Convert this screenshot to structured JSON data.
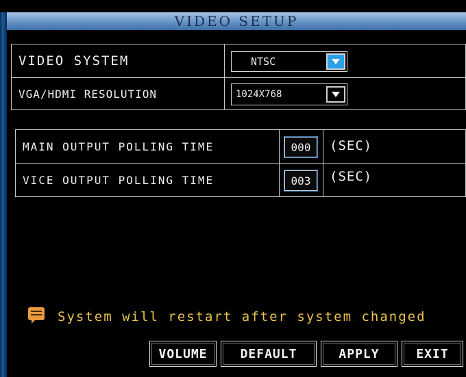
{
  "window": {
    "title": "VIDEO SETUP"
  },
  "settings": {
    "video_system": {
      "label": "VIDEO SYSTEM",
      "value": "NTSC"
    },
    "vga_hdmi_resolution": {
      "label": "VGA/HDMI RESOLUTION",
      "value": "1024X768"
    },
    "main_output_polling": {
      "label": "MAIN OUTPUT POLLING TIME",
      "value": "000",
      "unit": "(SEC)"
    },
    "vice_output_polling": {
      "label": "VICE OUTPUT POLLING TIME",
      "value": "003",
      "unit": "(SEC)"
    }
  },
  "notice": {
    "icon": "message-icon",
    "text": "System will restart after system changed",
    "color": "#e9c24a"
  },
  "buttons": {
    "volume": "VOLUME",
    "default": "DEFAULT",
    "apply": "APPLY",
    "exit": "EXIT"
  },
  "colors": {
    "title_bar": "#6f9bcc",
    "dropdown_highlight": "#2aa0e8",
    "notice_text": "#e9c24a"
  }
}
